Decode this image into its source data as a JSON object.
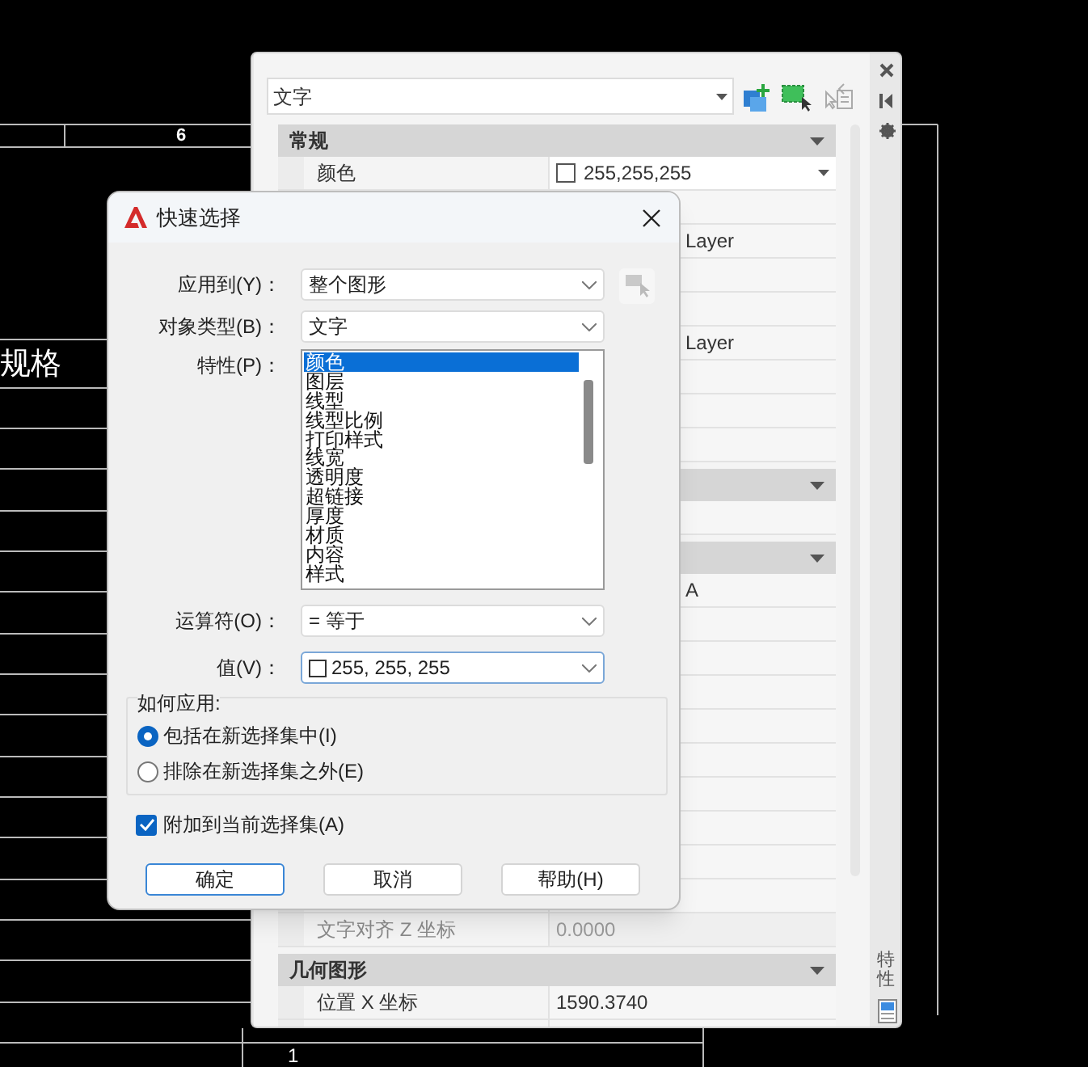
{
  "drawing": {
    "texts": [
      {
        "text": "6"
      },
      {
        "text": "规格"
      },
      {
        "text": "1"
      }
    ]
  },
  "properties_palette": {
    "object_type": "文字",
    "side_label": "特性",
    "sections": [
      {
        "title": "常规",
        "rows": [
          {
            "name": "颜色",
            "value": "255,255,255",
            "kind": "color"
          },
          {},
          {
            "value": "Layer",
            "kind": "partial"
          },
          {},
          {},
          {
            "value": "Layer",
            "kind": "partial"
          },
          {},
          {},
          {}
        ]
      },
      {
        "rows": [
          {}
        ]
      },
      {
        "rows": [
          {
            "value": "A",
            "kind": "partial"
          },
          {},
          {},
          {},
          {},
          {},
          {},
          {},
          {},
          {},
          {
            "name": "文字对齐 Z 坐标",
            "value": "0.0000",
            "disabled": true
          }
        ]
      },
      {
        "title": "几何图形",
        "rows": [
          {
            "name": "位置 X 坐标",
            "value": "1590.3740"
          },
          {}
        ]
      }
    ]
  },
  "quick_select": {
    "title": "快速选择",
    "fields": [
      {
        "kind": "dropdown",
        "label": "应用到(Y)：",
        "value": "整个图形",
        "has_pick_button": true
      },
      {
        "kind": "dropdown",
        "label": "对象类型(B)：",
        "value": "文字"
      },
      {
        "kind": "list",
        "label": "特性(P)：",
        "items": [
          {
            "label": "颜色",
            "selected": true
          },
          {
            "label": "图层",
            "selected": false
          },
          {
            "label": "线型",
            "selected": false
          },
          {
            "label": "线型比例",
            "selected": false
          },
          {
            "label": "打印样式",
            "selected": false
          },
          {
            "label": "线宽",
            "selected": false
          },
          {
            "label": "透明度",
            "selected": false
          },
          {
            "label": "超链接",
            "selected": false
          },
          {
            "label": "厚度",
            "selected": false
          },
          {
            "label": "材质",
            "selected": false
          },
          {
            "label": "内容",
            "selected": false
          },
          {
            "label": "样式",
            "selected": false
          }
        ]
      },
      {
        "kind": "dropdown",
        "label": "运算符(O)：",
        "value": "= 等于"
      },
      {
        "kind": "color",
        "label": "值(V)：",
        "value": "255, 255, 255"
      }
    ],
    "apply_group": {
      "title": "如何应用:",
      "options": [
        {
          "label": "包括在新选择集中(I)",
          "selected": true
        },
        {
          "label": "排除在新选择集之外(E)",
          "selected": false
        }
      ]
    },
    "append": {
      "label": "附加到当前选择集(A)",
      "checked": true
    },
    "buttons": [
      {
        "label": "确定",
        "default": true
      },
      {
        "label": "取消",
        "default": false
      },
      {
        "label": "帮助(H)",
        "default": false
      }
    ]
  }
}
